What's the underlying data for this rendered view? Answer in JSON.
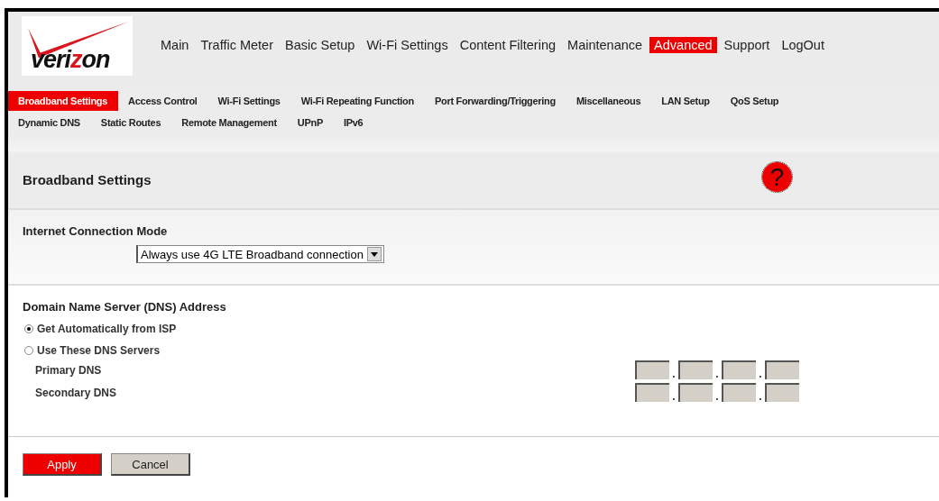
{
  "logo": {
    "before": "veri",
    "highlight": "z",
    "after": "on"
  },
  "main_nav": [
    {
      "label": "Main",
      "selected": false
    },
    {
      "label": "Traffic Meter",
      "selected": false
    },
    {
      "label": "Basic Setup",
      "selected": false
    },
    {
      "label": "Wi-Fi Settings",
      "selected": false
    },
    {
      "label": "Content Filtering",
      "selected": false
    },
    {
      "label": "Maintenance",
      "selected": false
    },
    {
      "label": "Advanced",
      "selected": true
    },
    {
      "label": "Support",
      "selected": false
    },
    {
      "label": "LogOut",
      "selected": false
    }
  ],
  "sub_tabs": [
    [
      {
        "label": "Broadband Settings",
        "selected": true
      },
      {
        "label": "Access Control",
        "selected": false
      },
      {
        "label": "Wi-Fi Settings",
        "selected": false
      },
      {
        "label": "Wi-Fi Repeating Function",
        "selected": false
      },
      {
        "label": "Port Forwarding/Triggering",
        "selected": false
      },
      {
        "label": "Miscellaneous",
        "selected": false
      },
      {
        "label": "LAN Setup",
        "selected": false
      },
      {
        "label": "QoS Setup",
        "selected": false
      }
    ],
    [
      {
        "label": "Dynamic DNS",
        "selected": false
      },
      {
        "label": "Static Routes",
        "selected": false
      },
      {
        "label": "Remote Management",
        "selected": false
      },
      {
        "label": "UPnP",
        "selected": false
      },
      {
        "label": "IPv6",
        "selected": false
      }
    ]
  ],
  "page_title": "Broadband Settings",
  "help": "?",
  "connection_mode": {
    "label": "Internet Connection Mode",
    "value": "Always use 4G LTE Broadband connection"
  },
  "dns": {
    "label": "Domain Name Server (DNS) Address",
    "separator": ".",
    "options": [
      {
        "label": "Get Automatically from ISP",
        "selected": true
      },
      {
        "label": "Use These DNS Servers",
        "selected": false
      }
    ],
    "servers": [
      {
        "label": "Primary DNS"
      },
      {
        "label": "Secondary DNS"
      }
    ]
  },
  "buttons": [
    {
      "label": "Apply",
      "kind": "primary"
    },
    {
      "label": "Cancel",
      "kind": "secondary"
    }
  ]
}
